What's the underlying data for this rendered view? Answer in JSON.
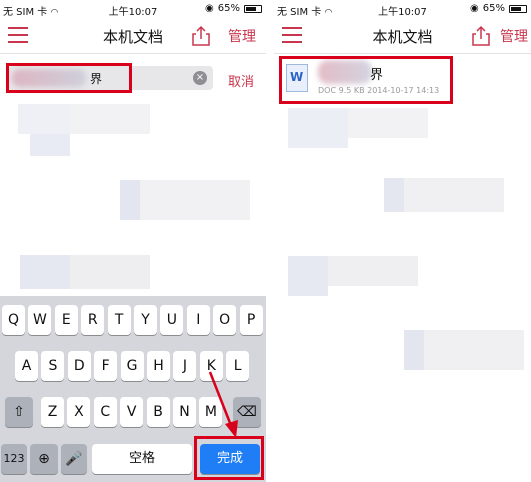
{
  "left_screen": {
    "status": {
      "carrier": "无 SIM 卡",
      "time": "上午10:07",
      "battery": "65%"
    },
    "nav": {
      "title": "本机文档",
      "manage": "管理"
    },
    "search": {
      "query_visible": "界",
      "cancel": "取消"
    },
    "keyboard": {
      "row1": [
        "Q",
        "W",
        "E",
        "R",
        "T",
        "Y",
        "U",
        "I",
        "O",
        "P"
      ],
      "row2": [
        "A",
        "S",
        "D",
        "F",
        "G",
        "H",
        "J",
        "K",
        "L"
      ],
      "row3": [
        "Z",
        "X",
        "C",
        "V",
        "B",
        "N",
        "M"
      ],
      "num_key": "123",
      "space": "空格",
      "done": "完成"
    }
  },
  "right_screen": {
    "status": {
      "carrier": "无 SIM 卡",
      "time": "上午10:07",
      "battery": "65%"
    },
    "nav": {
      "title": "本机文档",
      "manage": "管理"
    },
    "result": {
      "icon_letter": "W",
      "name_prefix": "",
      "name_visible": "界",
      "meta": "DOC  9.5 KB  2014-10-17 14:13"
    }
  },
  "colors": {
    "accent": "#c8364d",
    "highlight": "#d8001b",
    "done_key": "#1f7ef5",
    "keyboard_bg": "#d4d6db"
  }
}
